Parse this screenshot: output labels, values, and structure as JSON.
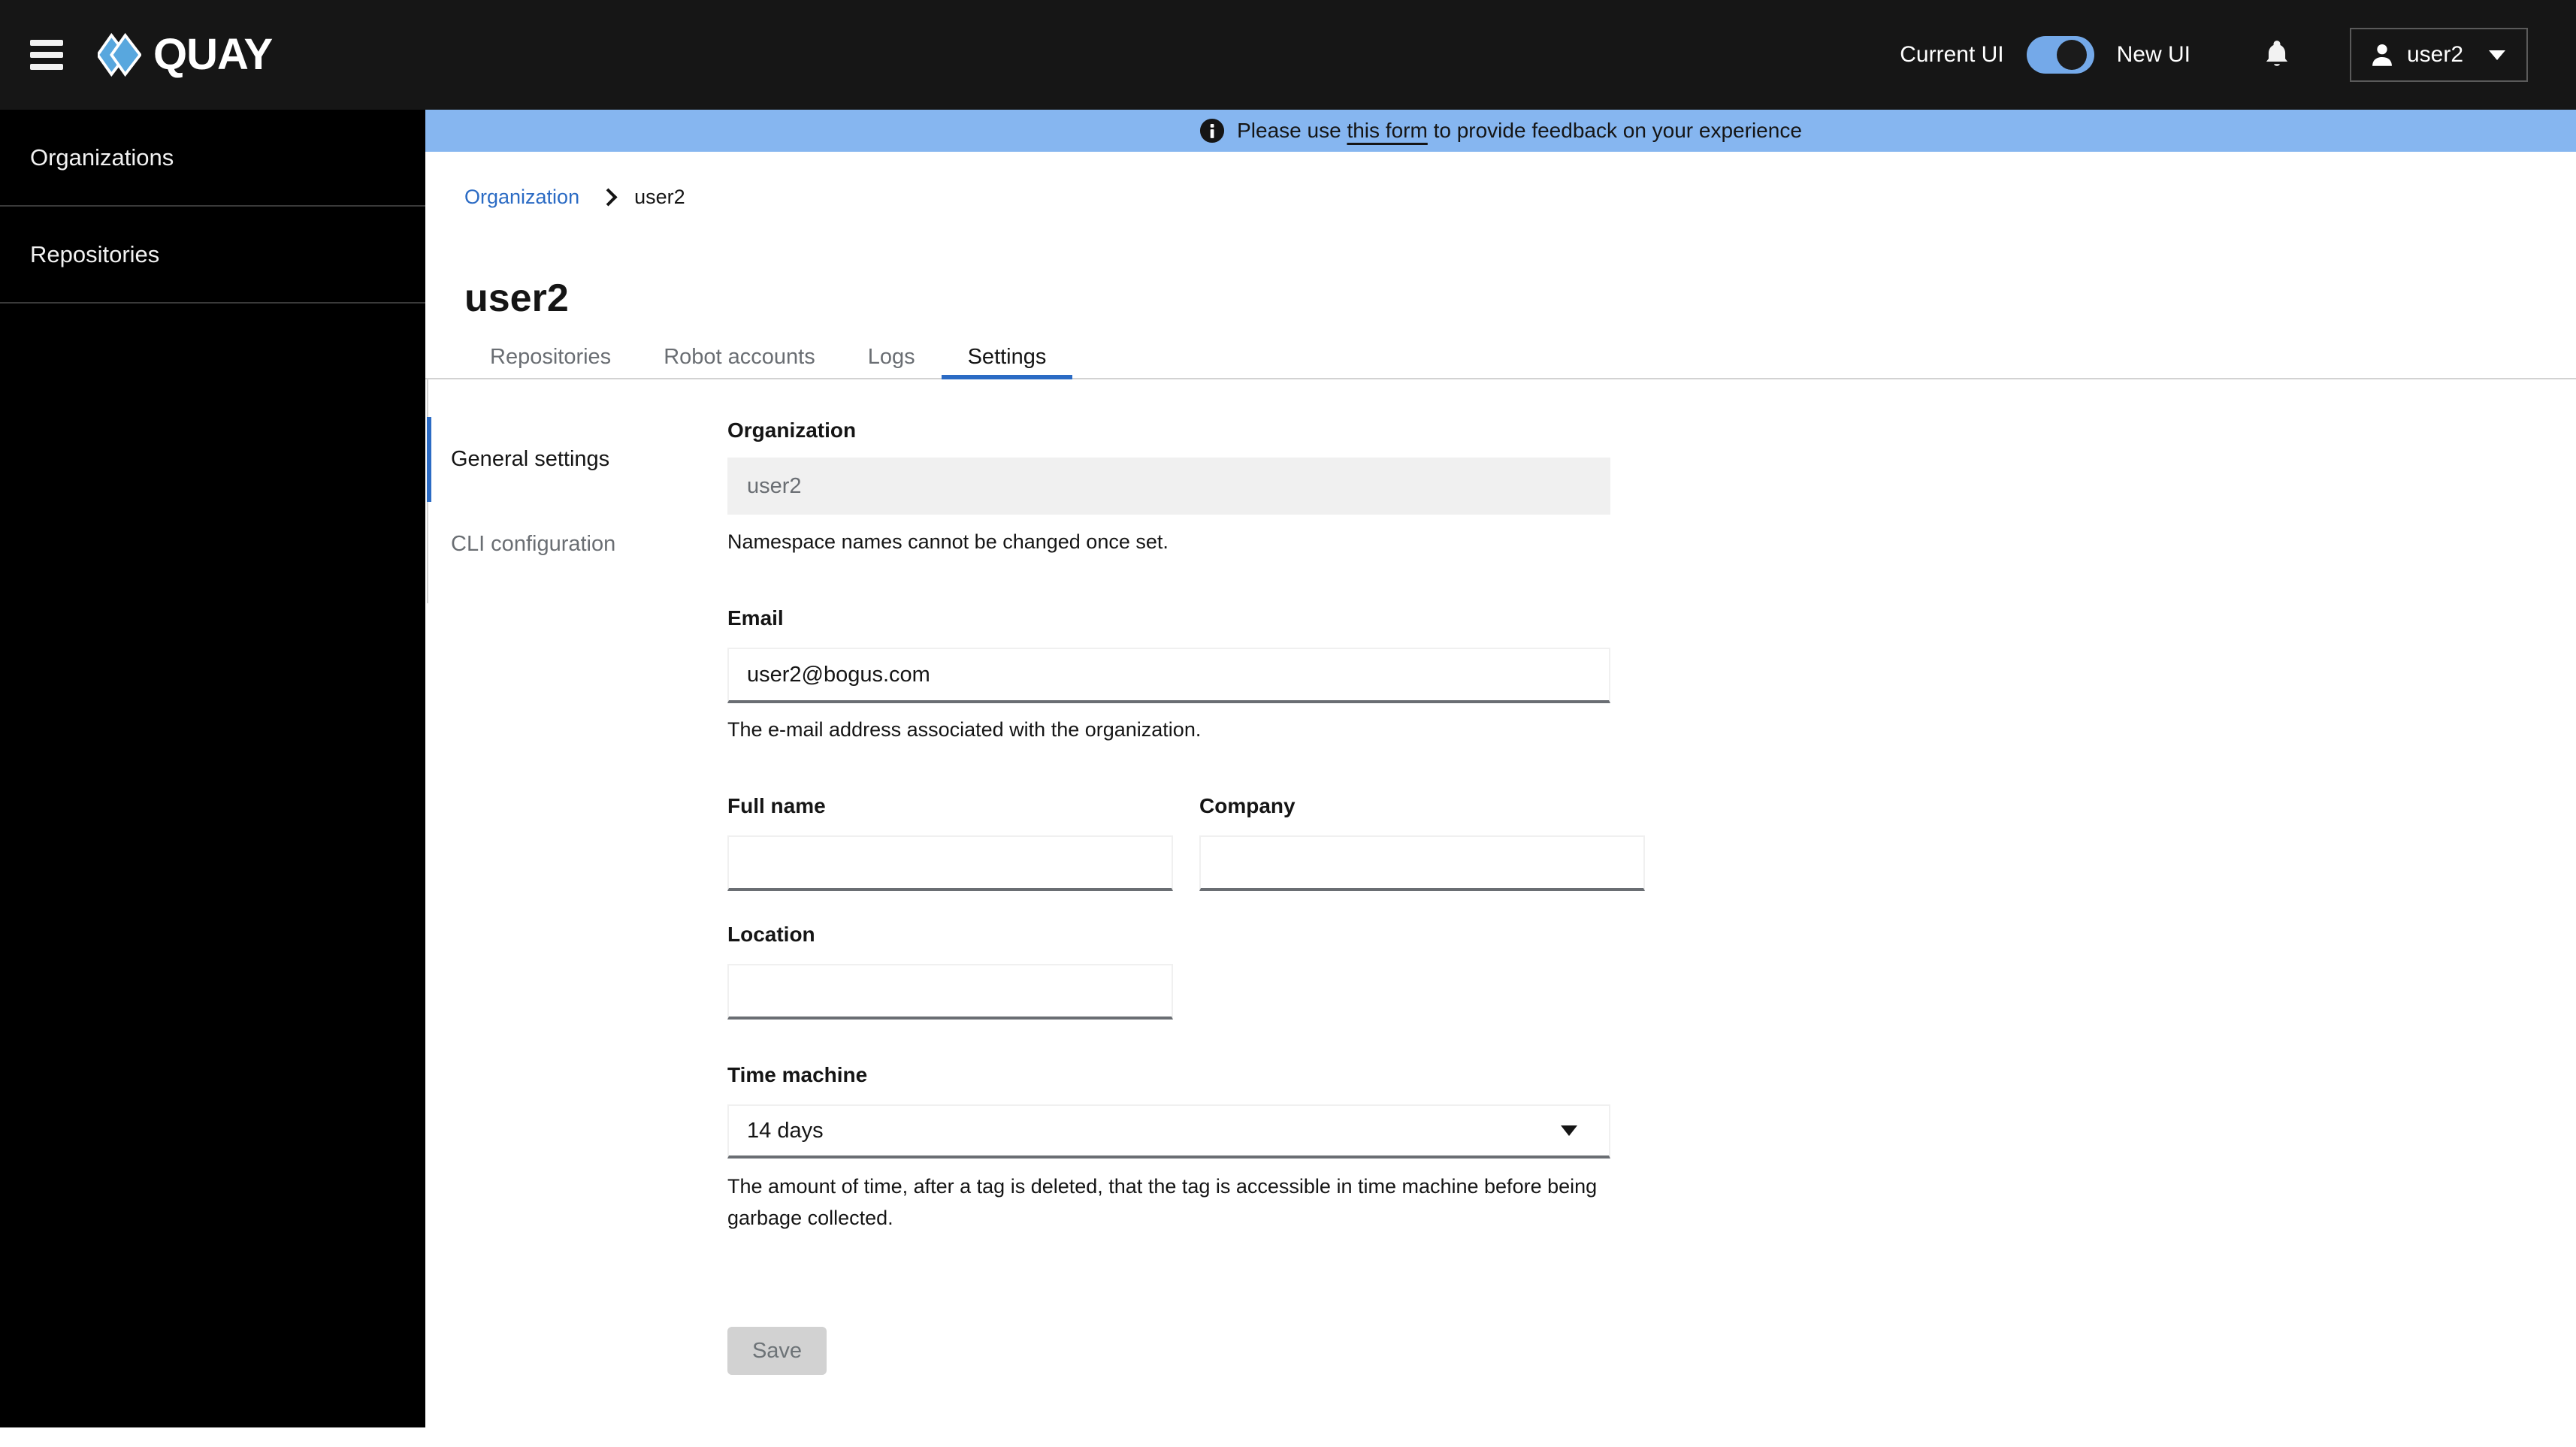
{
  "header": {
    "brand": "QUAY",
    "ui_toggle": {
      "left_label": "Current UI",
      "right_label": "New UI",
      "state": "on"
    },
    "user": {
      "name": "user2"
    }
  },
  "banner": {
    "text_before": "Please use ",
    "link_label": "this form",
    "text_after": " to provide feedback on your experience"
  },
  "sidebar": {
    "items": [
      {
        "label": "Organizations"
      },
      {
        "label": "Repositories"
      }
    ]
  },
  "breadcrumb": {
    "link": "Organization",
    "current": "user2"
  },
  "page": {
    "title": "user2"
  },
  "tabs": {
    "items": [
      {
        "label": "Repositories",
        "active": false
      },
      {
        "label": "Robot accounts",
        "active": false
      },
      {
        "label": "Logs",
        "active": false
      },
      {
        "label": "Settings",
        "active": true
      }
    ]
  },
  "settings_nav": {
    "items": [
      {
        "label": "General settings",
        "active": true
      },
      {
        "label": "CLI configuration",
        "active": false
      }
    ]
  },
  "form": {
    "organization": {
      "label": "Organization",
      "value": "user2",
      "disabled": true,
      "helper": "Namespace names cannot be changed once set."
    },
    "email": {
      "label": "Email",
      "value": "user2@bogus.com",
      "helper": "The e-mail address associated with the organization."
    },
    "full_name": {
      "label": "Full name",
      "value": ""
    },
    "company": {
      "label": "Company",
      "value": ""
    },
    "location": {
      "label": "Location",
      "value": ""
    },
    "time_machine": {
      "label": "Time machine",
      "value": "14 days",
      "helper": "The amount of time, after a tag is deleted, that the tag is accessible in time machine before being garbage collected."
    },
    "save_button": {
      "label": "Save",
      "disabled": true
    }
  },
  "colors": {
    "header_bg": "#161616",
    "sidebar_bg": "#000000",
    "banner_bg": "#86b6f0",
    "accent_blue": "#2b6bc4",
    "toggle_blue": "#74a9e9",
    "logo_blue": "#58a7de",
    "inactive_text": "#6a6e73",
    "disabled_bg": "#d2d2d2",
    "input_bottom_border": "#6a6e73"
  }
}
